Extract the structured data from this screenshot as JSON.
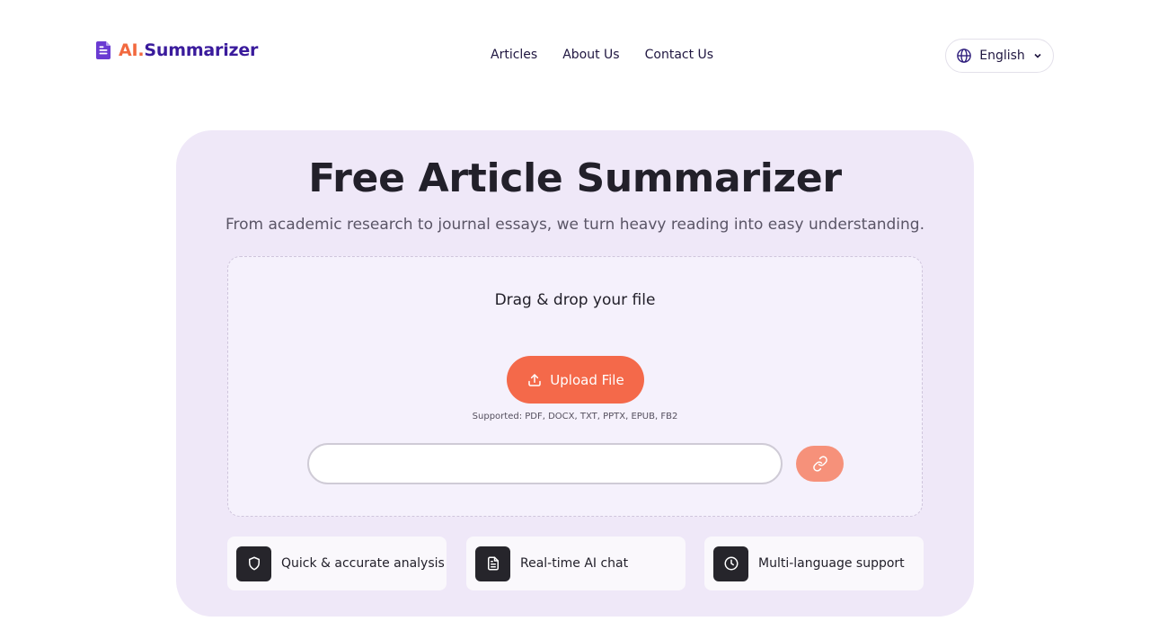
{
  "header": {
    "logo": {
      "ai": "AI.",
      "name": "Summarizer",
      "icon": "document-icon"
    },
    "nav": [
      {
        "label": "Articles"
      },
      {
        "label": "About Us"
      },
      {
        "label": "Contact Us"
      }
    ],
    "language": {
      "label": "English",
      "icon": "globe-icon"
    }
  },
  "hero": {
    "title": "Free Article Summarizer",
    "subtitle": "From academic research to journal essays, we turn heavy reading into easy understanding.",
    "dropzone": {
      "label": "Drag & drop your file",
      "upload_label": "Upload File",
      "supported": "Supported: PDF, DOCX, TXT, PPTX, EPUB, FB2",
      "url_value": "",
      "link_icon": "link-icon"
    },
    "features": [
      {
        "label": "Quick & accurate analysis",
        "icon": "shield-icon"
      },
      {
        "label": "Real-time AI chat",
        "icon": "document-icon"
      },
      {
        "label": "Multi-language support",
        "icon": "clock-icon"
      }
    ]
  },
  "colors": {
    "accent": "#f4694a",
    "brand": "#3a1b9c",
    "hero_bg": "#efe8f8"
  }
}
